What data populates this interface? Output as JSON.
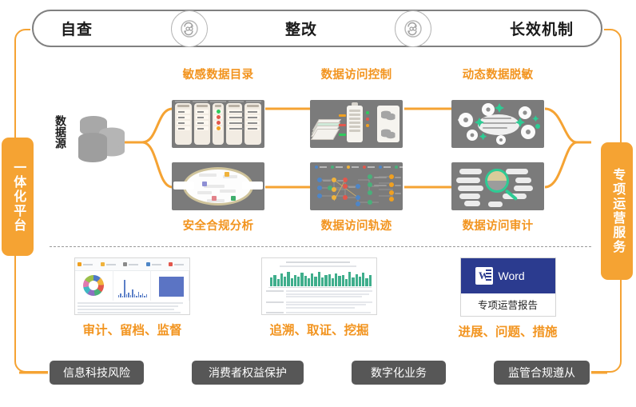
{
  "colors": {
    "accent_orange": "#f5a333",
    "caption_orange": "#f2941f",
    "chip_gray": "#575757",
    "thumb_gray": "#7b7b7b",
    "green": "#2ecb94",
    "word_blue": "#2b3b8f"
  },
  "top_bar": {
    "stages": [
      {
        "label": "自查"
      },
      {
        "label": "整改"
      },
      {
        "label": "长效机制"
      }
    ],
    "connector_icon": "cycle-refresh-icon"
  },
  "left_pill": {
    "label": "一体化平台"
  },
  "right_pill": {
    "label": "专项运营服务"
  },
  "data_source": {
    "label": "数据源",
    "icon": "database-stack-icon"
  },
  "modules": {
    "top_row": [
      {
        "caption": "敏感数据目录",
        "thumb": "sensitive-data-catalog-thumb"
      },
      {
        "caption": "数据访问控制",
        "thumb": "data-access-control-thumb"
      },
      {
        "caption": "动态数据脱敏",
        "thumb": "dynamic-data-masking-thumb"
      }
    ],
    "bottom_row": [
      {
        "caption": "安全合规分析",
        "thumb": "security-compliance-analysis-thumb"
      },
      {
        "caption": "数据访问轨迹",
        "thumb": "data-access-trace-thumb"
      },
      {
        "caption": "数据访问审计",
        "thumb": "data-access-audit-thumb"
      }
    ]
  },
  "deliverables": [
    {
      "caption": "审计、留档、监督",
      "thumb": "audit-dashboard-screenshot"
    },
    {
      "caption": "追溯、取证、挖掘",
      "thumb": "log-trace-screenshot"
    },
    {
      "caption": "进展、问题、措施",
      "thumb": "word-report-icon",
      "doc_title": "专项运营报告",
      "doc_app": "Word",
      "doc_mark": "W"
    }
  ],
  "bottom_chips": [
    {
      "label": "信息科技风险"
    },
    {
      "label": "消费者权益保护"
    },
    {
      "label": "数字化业务"
    },
    {
      "label": "监管合规遵从"
    }
  ]
}
